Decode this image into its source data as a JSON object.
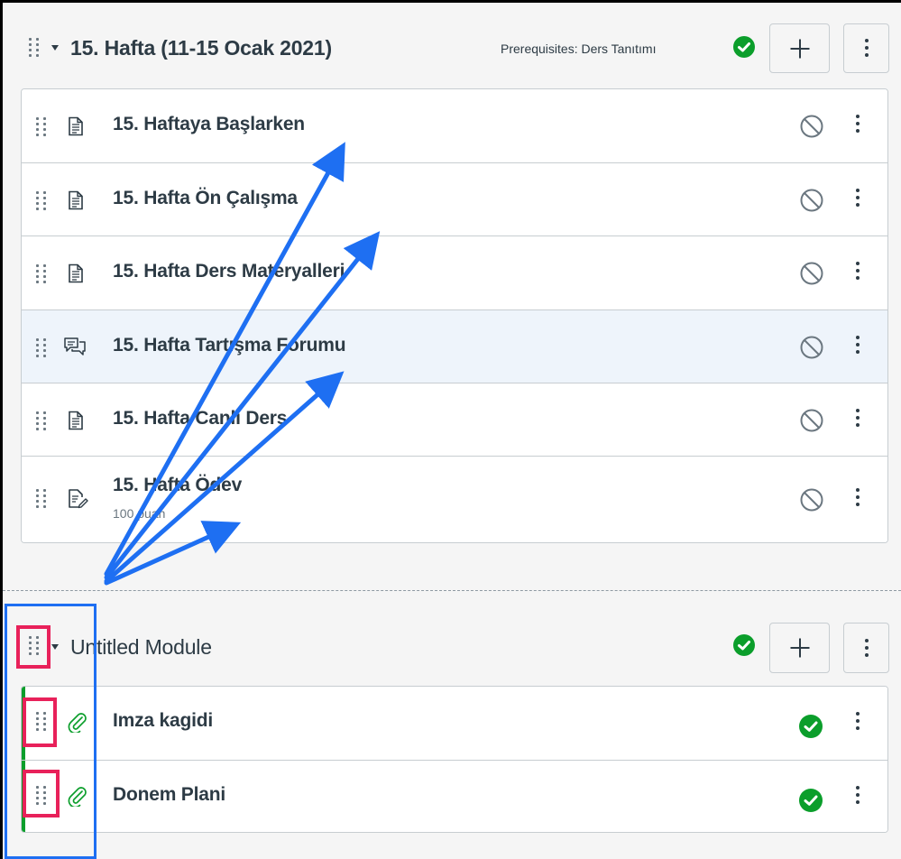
{
  "modules": [
    {
      "title": "15. Hafta (11-15 Ocak 2021)",
      "prerequisites": "Prerequisites: Ders Tanıtımı",
      "published": true,
      "items": [
        {
          "title": "15. Haftaya Başlarken",
          "icon": "page-icon",
          "status": "unpublished"
        },
        {
          "title": "15. Hafta Ön Çalışma",
          "icon": "page-icon",
          "status": "unpublished"
        },
        {
          "title": "15. Hafta Ders Materyalleri",
          "icon": "page-icon",
          "status": "unpublished"
        },
        {
          "title": "15. Hafta Tartışma Forumu",
          "icon": "discussion-icon",
          "status": "unpublished",
          "highlighted": true
        },
        {
          "title": "15. Hafta Canlı Ders",
          "icon": "page-icon",
          "status": "unpublished"
        },
        {
          "title": "15. Hafta Ödev",
          "subtitle": "100 puan",
          "icon": "assignment-icon",
          "status": "unpublished"
        }
      ]
    },
    {
      "title": "Untitled Module",
      "published": true,
      "items": [
        {
          "title": "Imza kagidi",
          "icon": "attachment-icon",
          "status": "published"
        },
        {
          "title": "Donem Plani",
          "icon": "attachment-icon",
          "status": "published"
        }
      ]
    }
  ],
  "colors": {
    "published_green": "#0b9e2b",
    "annotation_blue": "#1e6ff2",
    "annotation_red": "#e8215a",
    "highlight_row": "#eef4fb"
  }
}
